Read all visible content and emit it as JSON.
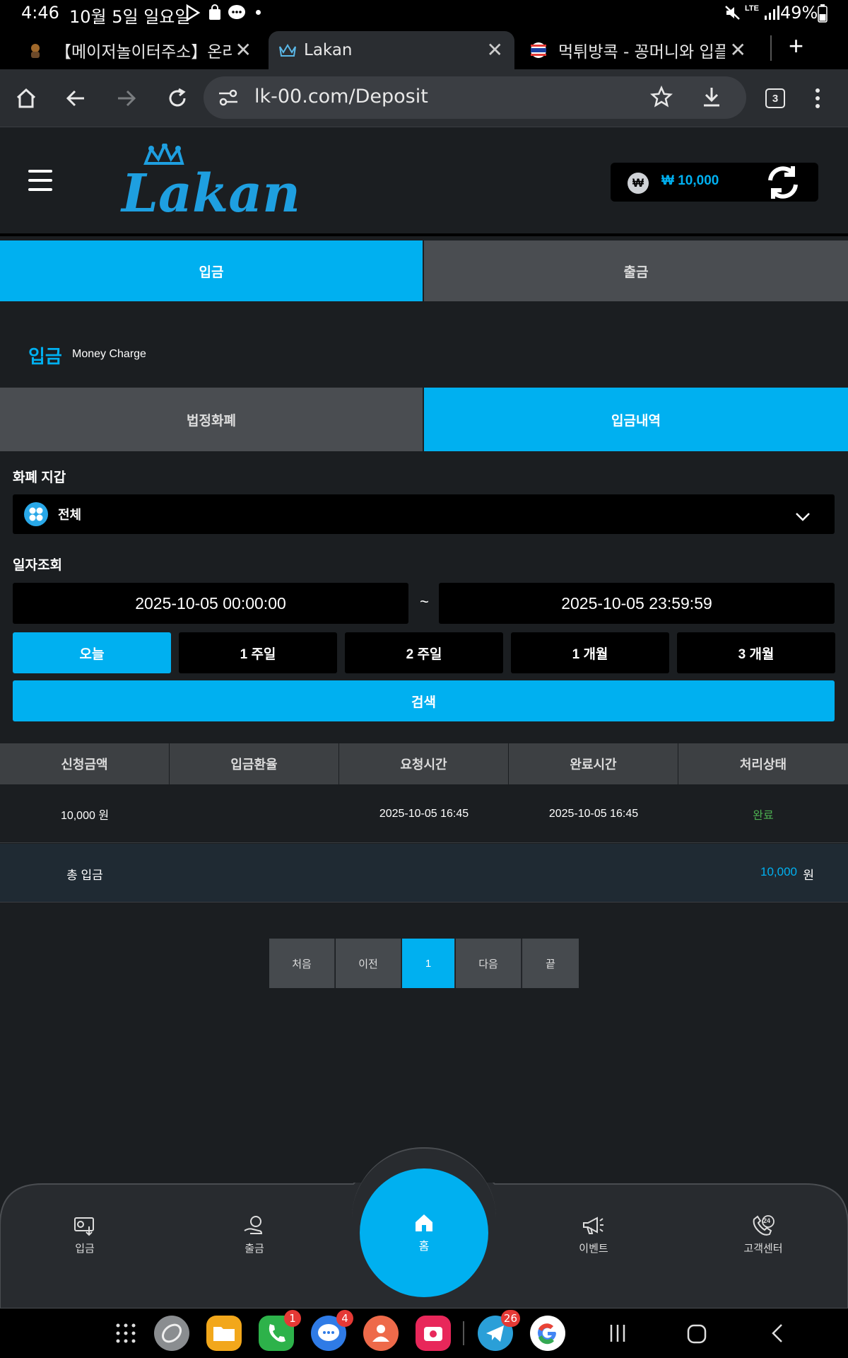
{
  "status_bar": {
    "time": "4:46",
    "date": "10월 5일 일요일",
    "battery": "49%",
    "network": "LTE"
  },
  "browser": {
    "tabs": [
      {
        "title": "【메이저놀이터주소】온라인"
      },
      {
        "title": "Lakan"
      },
      {
        "title": "먹튀방콕 - 꽁머니와 입플 주는"
      }
    ],
    "url": "lk-00.com/Deposit",
    "tab_count": "3"
  },
  "site": {
    "logo_text": "Lakan",
    "balance": "₩ 10,000",
    "currency_symbol": "₩"
  },
  "main_tabs": [
    {
      "label": "입금"
    },
    {
      "label": "출금"
    }
  ],
  "section": {
    "title": "입금",
    "subtitle": "Money Charge"
  },
  "sub_tabs": [
    {
      "label": "법정화폐"
    },
    {
      "label": "입금내역"
    }
  ],
  "wallet_filter": {
    "label": "화폐 지갑",
    "selected": "전체"
  },
  "date_filter": {
    "label": "일자조회",
    "start": "2025-10-05 00:00:00",
    "separator": "~",
    "end": "2025-10-05 23:59:59",
    "periods": [
      "오늘",
      "1 주일",
      "2 주일",
      "1 개월",
      "3 개월"
    ],
    "search_label": "검색"
  },
  "table": {
    "headers": [
      "신청금액",
      "입금환율",
      "요청시간",
      "완료시간",
      "처리상태"
    ],
    "rows": [
      {
        "amount": "10,000 원",
        "rate": "",
        "requested": "2025-10-05 16:45",
        "completed": "2025-10-05 16:45",
        "status": "완료"
      }
    ],
    "total_label": "총 입금",
    "total_value": "10,000",
    "total_unit": "원"
  },
  "pagination": {
    "first": "처음",
    "prev": "이전",
    "current": "1",
    "next": "다음",
    "last": "끝"
  },
  "bottom_nav": {
    "deposit": "입금",
    "withdraw": "출금",
    "home": "홈",
    "event": "이벤트",
    "support": "고객센터",
    "support_badge": "24"
  },
  "android_dock": {
    "phone_badge": "1",
    "messages_badge": "4",
    "telegram_badge": "26"
  },
  "colors": {
    "accent": "#00b0f0",
    "bg": "#1b1e21",
    "status_done": "#4caf50"
  }
}
